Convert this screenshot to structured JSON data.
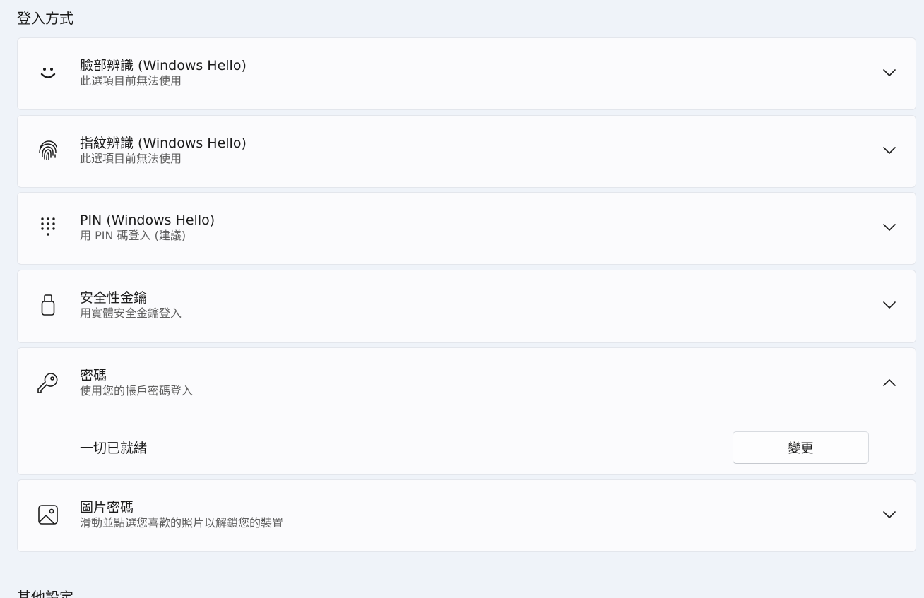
{
  "section_title": "登入方式",
  "next_section_title": "其他設定",
  "sign_in_options": [
    {
      "id": "face",
      "icon": "face-icon",
      "title": "臉部辨識 (Windows Hello)",
      "subtitle": "此選項目前無法使用",
      "expanded": false
    },
    {
      "id": "fingerprint",
      "icon": "fingerprint-icon",
      "title": "指紋辨識 (Windows Hello)",
      "subtitle": "此選項目前無法使用",
      "expanded": false
    },
    {
      "id": "pin",
      "icon": "keypad-icon",
      "title": "PIN (Windows Hello)",
      "subtitle": "用 PIN 碼登入 (建議)",
      "expanded": false
    },
    {
      "id": "security-key",
      "icon": "usb-key-icon",
      "title": "安全性金鑰",
      "subtitle": "用實體安全金鑰登入",
      "expanded": false
    },
    {
      "id": "password",
      "icon": "key-icon",
      "title": "密碼",
      "subtitle": "使用您的帳戶密碼登入",
      "expanded": true,
      "expanded_content": {
        "status": "一切已就緒",
        "button_label": "變更"
      }
    },
    {
      "id": "picture-password",
      "icon": "picture-icon",
      "title": "圖片密碼",
      "subtitle": "滑動並點選您喜歡的照片以解鎖您的裝置",
      "expanded": false
    }
  ]
}
